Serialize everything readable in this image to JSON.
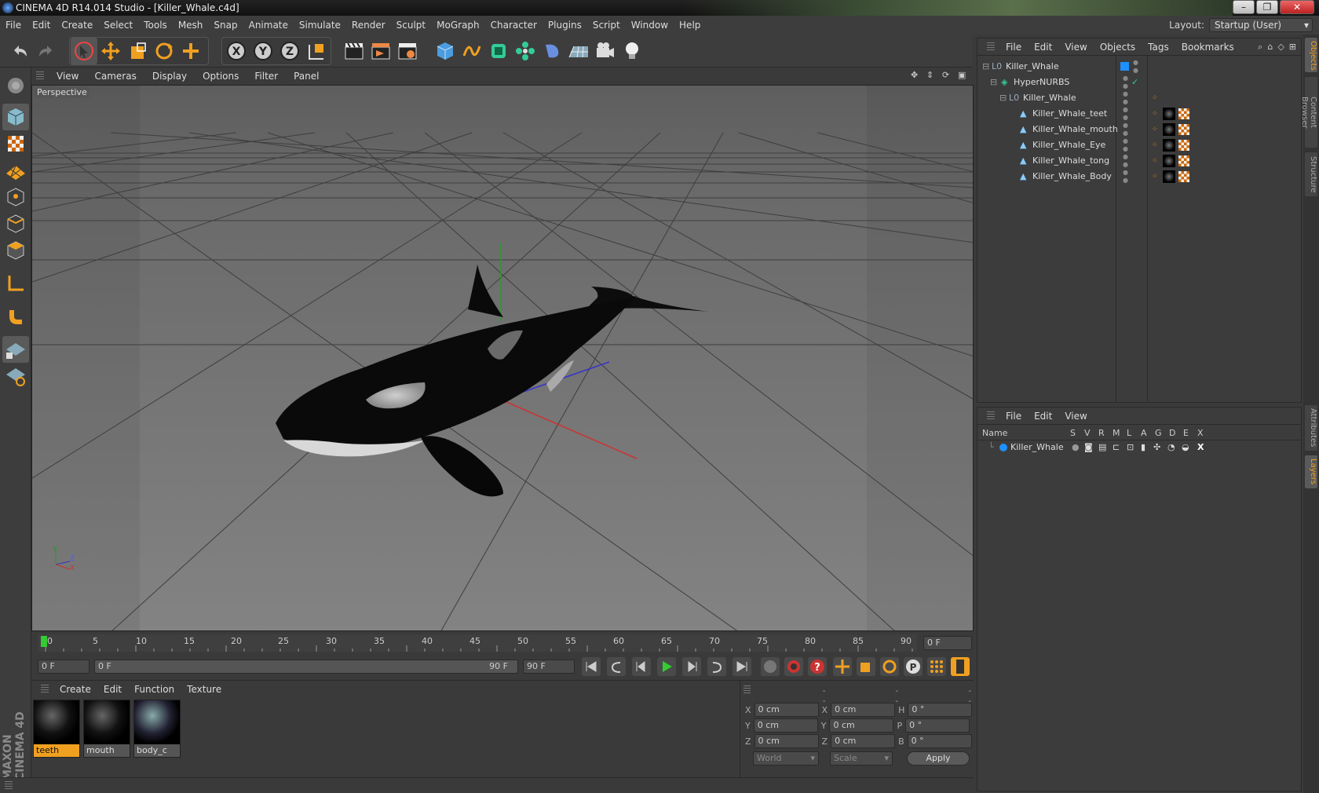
{
  "window": {
    "title": "CINEMA 4D R14.014 Studio - [Killer_Whale.c4d]",
    "minimize": "–",
    "maximize": "❐",
    "close": "✕"
  },
  "menu": [
    "File",
    "Edit",
    "Create",
    "Select",
    "Tools",
    "Mesh",
    "Snap",
    "Animate",
    "Simulate",
    "Render",
    "Sculpt",
    "MoGraph",
    "Character",
    "Plugins",
    "Script",
    "Window",
    "Help"
  ],
  "layout": {
    "label": "Layout:",
    "value": "Startup (User)"
  },
  "viewport": {
    "menu": [
      "View",
      "Cameras",
      "Display",
      "Options",
      "Filter",
      "Panel"
    ],
    "label": "Perspective",
    "axes": {
      "y": "Y",
      "z": "Z",
      "x": "X"
    }
  },
  "timeline": {
    "ticks": [
      "0",
      "5",
      "10",
      "15",
      "20",
      "25",
      "30",
      "35",
      "40",
      "45",
      "50",
      "55",
      "60",
      "65",
      "70",
      "75",
      "80",
      "85",
      "90"
    ],
    "current_frame": "0 F"
  },
  "transport": {
    "start": "0 F",
    "range_start": "0 F",
    "range_end": "90 F",
    "end": "90 F"
  },
  "materials": {
    "menu": [
      "Create",
      "Edit",
      "Function",
      "Texture"
    ],
    "items": [
      {
        "name": "teeth",
        "selected": true
      },
      {
        "name": "mouth",
        "selected": false
      },
      {
        "name": "body_c",
        "selected": false
      }
    ]
  },
  "coords": {
    "headers": [
      "--",
      "--",
      "--"
    ],
    "rows": [
      {
        "a": "X",
        "av": "0 cm",
        "b": "X",
        "bv": "0 cm",
        "c": "H",
        "cv": "0 °"
      },
      {
        "a": "Y",
        "av": "0 cm",
        "b": "Y",
        "bv": "0 cm",
        "c": "P",
        "cv": "0 °"
      },
      {
        "a": "Z",
        "av": "0 cm",
        "b": "Z",
        "bv": "0 cm",
        "c": "B",
        "cv": "0 °"
      }
    ],
    "mode": "World",
    "scale": "Scale",
    "apply": "Apply"
  },
  "objects": {
    "menu": [
      "File",
      "Edit",
      "View",
      "Objects",
      "Tags",
      "Bookmarks"
    ],
    "tree": [
      {
        "name": "Killer_Whale",
        "indent": 0,
        "kind": "null"
      },
      {
        "name": "HyperNURBS",
        "indent": 1,
        "kind": "nurbs"
      },
      {
        "name": "Killer_Whale",
        "indent": 2,
        "kind": "null"
      },
      {
        "name": "Killer_Whale_teet",
        "indent": 3,
        "kind": "poly"
      },
      {
        "name": "Killer_Whale_mouth",
        "indent": 3,
        "kind": "poly"
      },
      {
        "name": "Killer_Whale_Eye",
        "indent": 3,
        "kind": "poly"
      },
      {
        "name": "Killer_Whale_tong",
        "indent": 3,
        "kind": "poly"
      },
      {
        "name": "Killer_Whale_Body",
        "indent": 3,
        "kind": "poly"
      }
    ]
  },
  "layers": {
    "menu": [
      "File",
      "Edit",
      "View"
    ],
    "columns": [
      "Name",
      "S",
      "V",
      "R",
      "M",
      "L",
      "A",
      "G",
      "D",
      "E",
      "X"
    ],
    "rows": [
      {
        "name": "Killer_Whale",
        "color": "#1e90ff"
      }
    ]
  },
  "sidetabs": [
    "Objects",
    "Content Browser",
    "Structure",
    "Attributes",
    "Layers"
  ],
  "brand": "MAXON CINEMA 4D"
}
